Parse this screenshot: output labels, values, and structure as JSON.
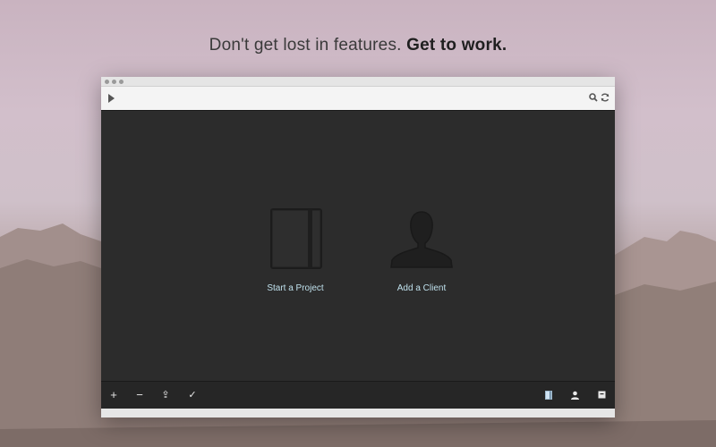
{
  "headline": {
    "regular": "Don't get lost in features.",
    "bold": "Get to work."
  },
  "window": {
    "toolbar": {
      "play_icon": "play-icon",
      "search_icon": "search-icon",
      "refresh_icon": "refresh-icon"
    },
    "tiles": [
      {
        "label": "Start a Project",
        "icon": "notebook-icon"
      },
      {
        "label": "Add a Client",
        "icon": "person-silhouette-icon"
      }
    ],
    "bottom_bar": {
      "left_buttons": [
        {
          "glyph": "+",
          "icon": "add-icon"
        },
        {
          "glyph": "−",
          "icon": "remove-icon"
        },
        {
          "glyph": "⇪",
          "icon": "share-icon"
        },
        {
          "glyph": "✓",
          "icon": "checkmark-icon"
        }
      ],
      "right_buttons": [
        {
          "icon": "projects-view-icon"
        },
        {
          "icon": "clients-view-icon"
        },
        {
          "icon": "archive-icon"
        }
      ]
    }
  },
  "colors": {
    "accent_label": "#bfe0ec",
    "window_bg": "#2c2c2c",
    "toolbar_bg": "#f4f4f4"
  }
}
